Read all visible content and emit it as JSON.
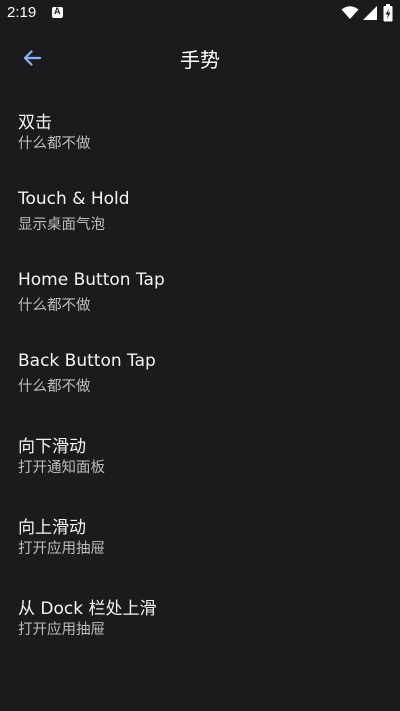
{
  "status_bar": {
    "time": "2:19",
    "icons": [
      "app-notification-icon",
      "wifi-icon",
      "signal-icon",
      "battery-charging-icon"
    ]
  },
  "toolbar": {
    "back_icon": "arrow-back-icon",
    "title": "手势"
  },
  "colors": {
    "background": "#1b1b1d",
    "accent": "#8ab4f8",
    "title_text": "#f4f4f4",
    "summary_text": "#bdbdbd"
  },
  "gestures": [
    {
      "title": "双击",
      "summary": "什么都不做"
    },
    {
      "title": "Touch & Hold",
      "summary": "显示桌面气泡"
    },
    {
      "title": "Home Button Tap",
      "summary": "什么都不做"
    },
    {
      "title": "Back Button Tap",
      "summary": "什么都不做"
    },
    {
      "title": "向下滑动",
      "summary": "打开通知面板"
    },
    {
      "title": "向上滑动",
      "summary": "打开应用抽屉"
    },
    {
      "title": "从 Dock 栏处上滑",
      "summary": "打开应用抽屉"
    }
  ]
}
